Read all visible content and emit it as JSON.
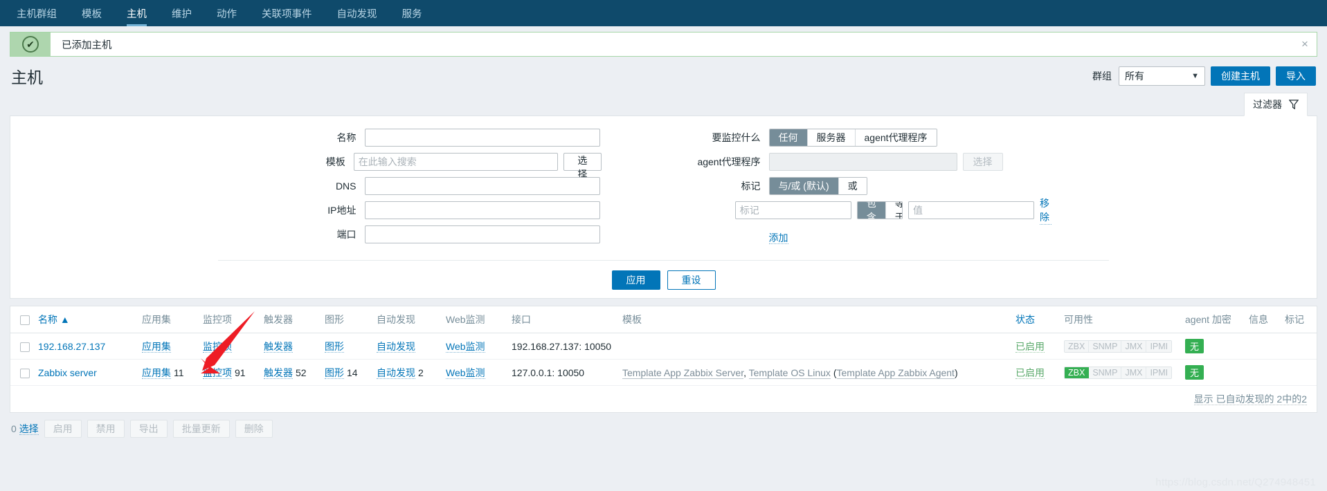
{
  "topnav": {
    "items": [
      {
        "label": "主机群组",
        "active": false
      },
      {
        "label": "模板",
        "active": false
      },
      {
        "label": "主机",
        "active": true
      },
      {
        "label": "维护",
        "active": false
      },
      {
        "label": "动作",
        "active": false
      },
      {
        "label": "关联项事件",
        "active": false
      },
      {
        "label": "自动发现",
        "active": false
      },
      {
        "label": "服务",
        "active": false
      }
    ]
  },
  "message": {
    "text": "已添加主机",
    "icon": "check-circle-icon",
    "close": "×",
    "accent": "#aed6ae"
  },
  "header": {
    "title": "主机",
    "group_label": "群组",
    "group_value": "所有",
    "create_host": "创建主机",
    "import": "导入",
    "accent": "#0275b8"
  },
  "filter_tab": {
    "label": "过滤器",
    "icon": "funnel-icon"
  },
  "filter": {
    "left": [
      {
        "label": "名称",
        "value": "",
        "placeholder": "",
        "name": "name-field"
      },
      {
        "label": "模板",
        "value": "",
        "placeholder": "在此输入搜索",
        "name": "template-field",
        "button": "选择"
      },
      {
        "label": "DNS",
        "value": "",
        "placeholder": "",
        "name": "dns-field"
      },
      {
        "label": "IP地址",
        "value": "",
        "placeholder": "",
        "name": "ip-field"
      },
      {
        "label": "端口",
        "value": "",
        "placeholder": "",
        "name": "port-field"
      }
    ],
    "monitored_by": {
      "label": "要监控什么",
      "options": [
        "任何",
        "服务器",
        "agent代理程序"
      ],
      "selected": "任何"
    },
    "proxy": {
      "label": "agent代理程序",
      "value": "",
      "placeholder": "",
      "button": "选择"
    },
    "tags": {
      "label": "标记",
      "mode_options": [
        "与/或 (默认)",
        "或"
      ],
      "mode_selected": "与/或 (默认)",
      "tag_placeholder": "标记",
      "tag_value": "",
      "operator_options": [
        "包含",
        "等于"
      ],
      "operator_selected": "包含",
      "value_placeholder": "值",
      "value_value": "",
      "remove_label": "移除",
      "add_label": "添加"
    },
    "actions": {
      "apply": "应用",
      "reset": "重设"
    }
  },
  "table": {
    "columns": [
      "名称 ▲",
      "应用集",
      "监控项",
      "触发器",
      "图形",
      "自动发现",
      "Web监测",
      "接口",
      "模板",
      "状态",
      "可用性",
      "agent 加密",
      "信息",
      "标记"
    ],
    "rows": [
      {
        "name": "192.168.27.137",
        "applications": {
          "label": "应用集",
          "count": ""
        },
        "items": {
          "label": "监控项",
          "count": ""
        },
        "triggers": {
          "label": "触发器",
          "count": ""
        },
        "graphs": {
          "label": "图形",
          "count": ""
        },
        "discovery": {
          "label": "自动发现",
          "count": ""
        },
        "web": {
          "label": "Web监测",
          "count": ""
        },
        "interface": "192.168.27.137: 10050",
        "templates": [],
        "templates_text": "",
        "status": "已启用",
        "availability": [
          {
            "label": "ZBX",
            "state": "off"
          },
          {
            "label": "SNMP",
            "state": "off"
          },
          {
            "label": "JMX",
            "state": "off"
          },
          {
            "label": "IPMI",
            "state": "off"
          }
        ],
        "encryption": "无",
        "info": "",
        "tags": ""
      },
      {
        "name": "Zabbix server",
        "applications": {
          "label": "应用集",
          "count": "11"
        },
        "items": {
          "label": "监控项",
          "count": "91"
        },
        "triggers": {
          "label": "触发器",
          "count": "52"
        },
        "graphs": {
          "label": "图形",
          "count": "14"
        },
        "discovery": {
          "label": "自动发现",
          "count": "2"
        },
        "web": {
          "label": "Web监测",
          "count": ""
        },
        "interface": "127.0.0.1: 10050",
        "templates": [
          "Template App Zabbix Server",
          "Template OS Linux",
          "Template App Zabbix Agent"
        ],
        "templates_text": "Template App Zabbix Server, Template OS Linux (Template App Zabbix Agent)",
        "status": "已启用",
        "availability": [
          {
            "label": "ZBX",
            "state": "ok"
          },
          {
            "label": "SNMP",
            "state": "off"
          },
          {
            "label": "JMX",
            "state": "off"
          },
          {
            "label": "IPMI",
            "state": "off"
          }
        ],
        "encryption": "无",
        "info": "",
        "tags": ""
      }
    ],
    "footer": "显示 已自动发现的 2中的2"
  },
  "bottom_bar": {
    "selection": {
      "count": "0",
      "label": "选择"
    },
    "buttons": [
      "启用",
      "禁用",
      "导出",
      "批量更新",
      "删除"
    ]
  },
  "watermark": "https://blog.csdn.net/Q274948451"
}
